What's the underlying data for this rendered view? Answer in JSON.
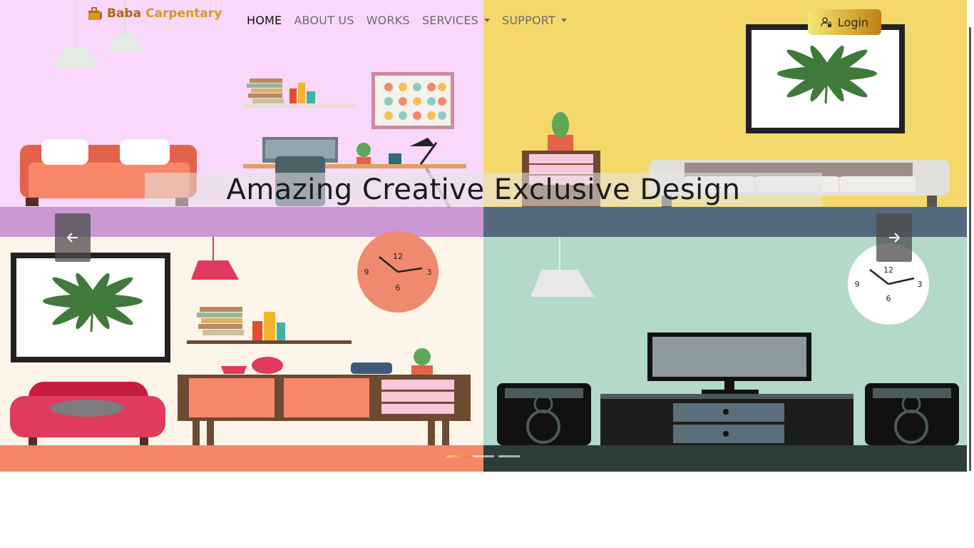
{
  "brand": {
    "name_part1": "Baba",
    "name_part2": "Carpentary"
  },
  "nav": {
    "items": [
      {
        "label": "HOME",
        "active": true,
        "dropdown": false
      },
      {
        "label": "ABOUT US",
        "active": false,
        "dropdown": false
      },
      {
        "label": "WORKS",
        "active": false,
        "dropdown": false
      },
      {
        "label": "SERVICES",
        "active": false,
        "dropdown": true
      },
      {
        "label": "SUPPORT",
        "active": false,
        "dropdown": true
      }
    ],
    "login_label": "Login"
  },
  "carousel": {
    "caption": "Amazing Creative Exclusive Design",
    "slide_count": 3,
    "active_slide": 1,
    "prev_icon": "arrow-left-icon",
    "next_icon": "arrow-right-icon"
  },
  "colors": {
    "room_pink": "#f9d8fb",
    "room_yellow": "#f5d86a",
    "room_cream": "#fdf4ea",
    "room_mint": "#b3d9c9",
    "brand_gold": "#d99a18"
  },
  "clocks": [
    {
      "labels": [
        "12",
        "3",
        "6",
        "9"
      ]
    },
    {
      "labels": [
        "12",
        "3",
        "6",
        "9"
      ]
    }
  ]
}
